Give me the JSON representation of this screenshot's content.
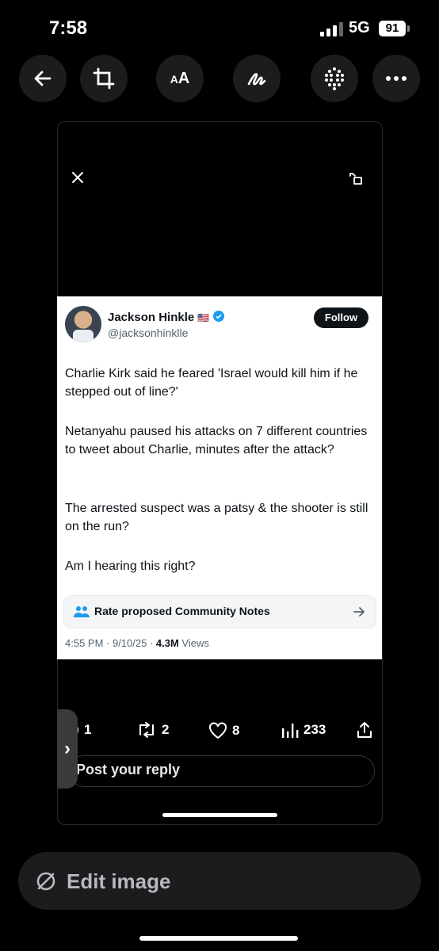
{
  "status_bar": {
    "time": "7:58",
    "network": "5G",
    "battery": "91"
  },
  "toolbar": {
    "items": [
      "back-icon",
      "crop-icon",
      "text-size-icon",
      "markup-icon",
      "dots-grid-icon",
      "more-icon"
    ],
    "text_size_label": "AA"
  },
  "tweet": {
    "name": "Jackson Hinkle",
    "flag": "🇺🇸",
    "handle": "@jacksonhinklle",
    "follow_label": "Follow",
    "paragraphs": [
      "Charlie Kirk said he feared 'Israel would kill him if he stepped out of line?'",
      "Netanyahu paused his attacks on 7 different countries to tweet about Charlie, minutes after the attack?",
      "The arrested suspect was a patsy & the shooter is still on the run?",
      "Am I hearing this right?"
    ],
    "community_notes_label": "Rate proposed Community Notes",
    "timestamp": "4:55 PM · 9/10/25 · ",
    "views_count": "4.3M",
    "views_label": " Views"
  },
  "engagement": {
    "replies": "1",
    "reposts": "2",
    "likes": "8",
    "views": "233"
  },
  "reply_placeholder": "Post your reply",
  "edit_label": "Edit image",
  "colors": {
    "accent_verified": "#1d9bf0",
    "background": "#000000",
    "card": "#ffffff"
  }
}
